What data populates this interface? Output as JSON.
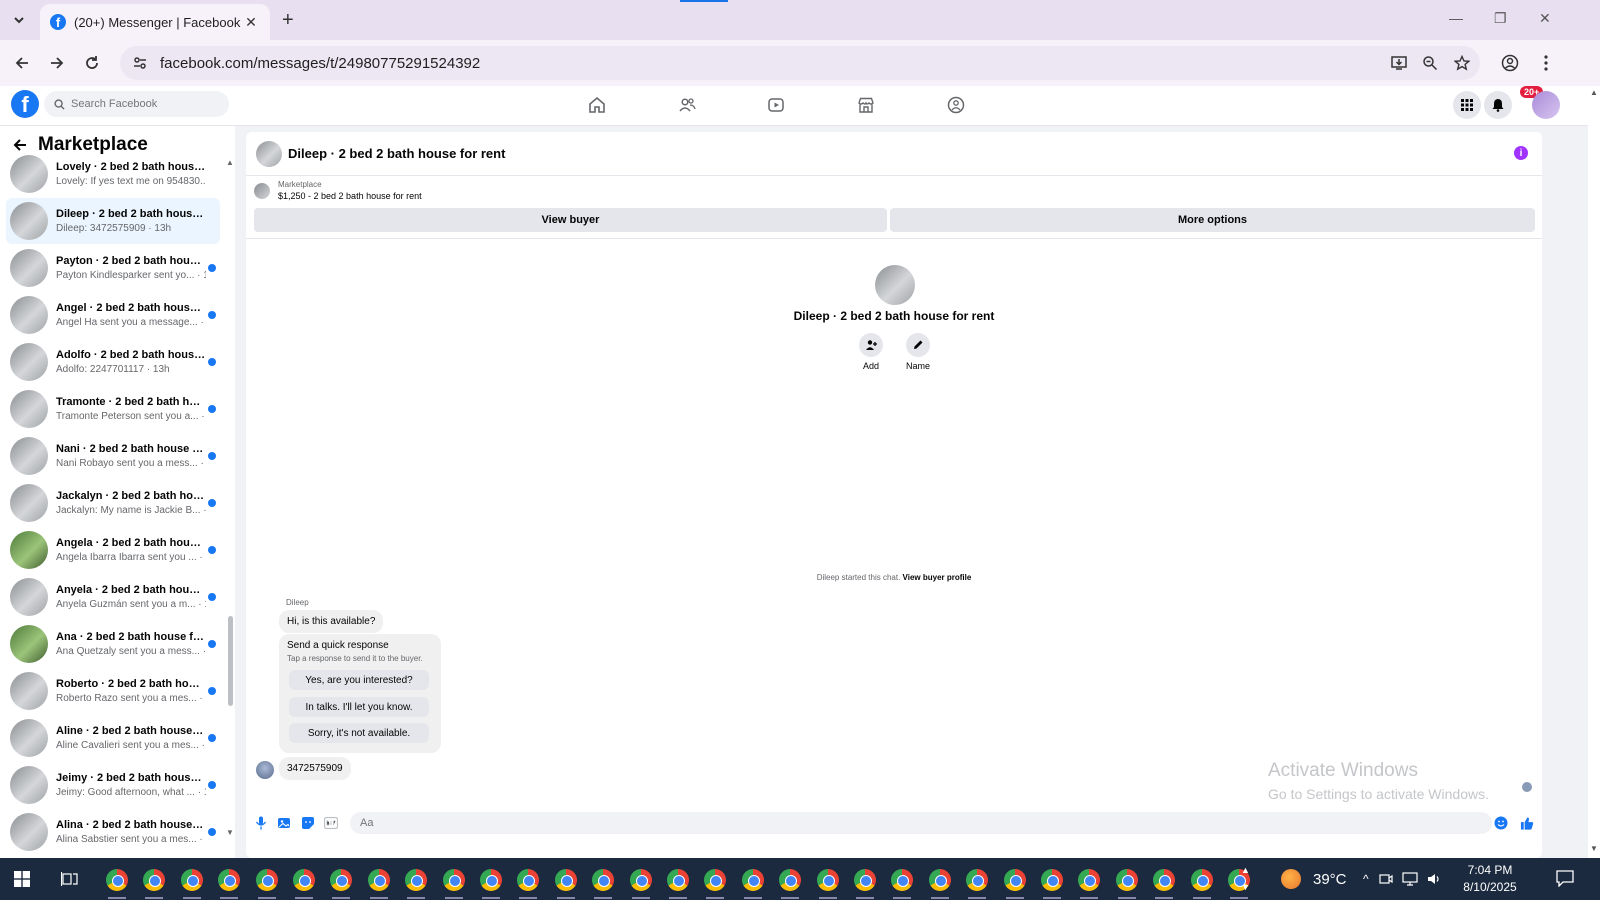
{
  "browser": {
    "tab_title": "(20+) Messenger | Facebook",
    "url": "facebook.com/messages/t/24980775291524392"
  },
  "header": {
    "search_placeholder": "Search Facebook",
    "notif_count": "20+"
  },
  "sidebar": {
    "title": "Marketplace",
    "conversations": [
      {
        "name": "Lovely · 2 bed 2 bath house for...",
        "preview": "Lovely: If yes text me on 954830... · 13h",
        "unread": false
      },
      {
        "name": "Dileep · 2 bed 2 bath house for...",
        "preview": "Dileep: 3472575909 · 13h",
        "unread": false,
        "active": true
      },
      {
        "name": "Payton · 2 bed 2 bath house f...",
        "preview": "Payton Kindlesparker sent yo... · 13h",
        "unread": true
      },
      {
        "name": "Angel · 2 bed 2 bath house fo...",
        "preview": "Angel Ha sent you a message... · 13h",
        "unread": true
      },
      {
        "name": "Adolfo · 2 bed 2 bath house f...",
        "preview": "Adolfo: 2247701117 · 13h",
        "unread": true
      },
      {
        "name": "Tramonte · 2 bed 2 bath hous...",
        "preview": "Tramonte Peterson sent you a... · 13h",
        "unread": true
      },
      {
        "name": "Nani · 2 bed 2 bath house for...",
        "preview": "Nani Robayo sent you a mess... · 13h",
        "unread": true
      },
      {
        "name": "Jackalyn · 2 bed 2 bath house...",
        "preview": "Jackalyn: My name is Jackie B... · 13h",
        "unread": true
      },
      {
        "name": "Angela · 2 bed 2 bath house f...",
        "preview": "Angela Ibarra Ibarra sent you ... · 13h",
        "unread": true
      },
      {
        "name": "Anyela · 2 bed 2 bath house f...",
        "preview": "Anyela Guzmán sent you a m... · 13h",
        "unread": true
      },
      {
        "name": "Ana · 2 bed 2 bath house for ...",
        "preview": "Ana Quetzaly sent you a mess... · 14h",
        "unread": true
      },
      {
        "name": "Roberto · 2 bed 2 bath house...",
        "preview": "Roberto Razo sent you a mes... · 14h",
        "unread": true
      },
      {
        "name": "Aline · 2 bed 2 bath house for...",
        "preview": "Aline Cavalieri sent you a mes... · 14h",
        "unread": true
      },
      {
        "name": "Jeimy · 2 bed 2 bath house fo...",
        "preview": "Jeimy: Good afternoon, what ... · 14h",
        "unread": true
      },
      {
        "name": "Alina · 2 bed 2 bath house for...",
        "preview": "Alina Sabstier sent you a mes... · 14h",
        "unread": true
      }
    ]
  },
  "chat": {
    "title": "Dileep · 2 bed 2 bath house for rent",
    "listing_source": "Marketplace",
    "listing_detail": "$1,250 - 2 bed 2 bath house for rent",
    "view_buyer": "View buyer",
    "more_options": "More options",
    "center_name": "Dileep · 2 bed 2 bath house for rent",
    "add_label": "Add",
    "name_label": "Name",
    "started_prefix": "Dileep started this chat.",
    "started_link": "View buyer profile",
    "sender": "Dileep",
    "first_message": "Hi, is this available?",
    "quick_title": "Send a quick response",
    "quick_sub": "Tap a response to send it to the buyer.",
    "quick_replies": [
      "Yes, are you interested?",
      "In talks. I'll let you know.",
      "Sorry, it's not available."
    ],
    "reply_message": "3472575909",
    "compose_placeholder": "Aa"
  },
  "watermark": {
    "line1": "Activate Windows",
    "line2": "Go to Settings to activate Windows."
  },
  "taskbar": {
    "temperature": "39°C",
    "time": "7:04 PM",
    "date": "8/10/2025"
  },
  "colors": {
    "brand": "#1877f2",
    "unread_dot": "#1877f2",
    "info": "#a033ff",
    "taskbar": "#1b2a3e"
  }
}
